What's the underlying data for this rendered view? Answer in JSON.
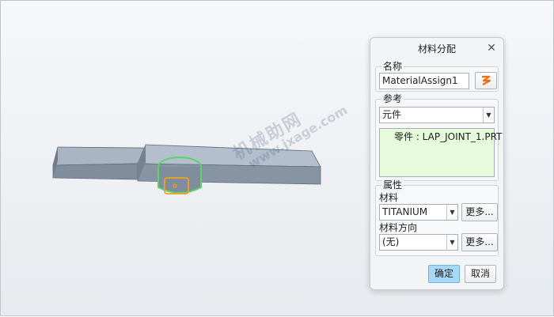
{
  "viewport": {
    "watermark_line1": "机械助网",
    "watermark_line2": "www.jxage.com",
    "model_colors": {
      "plate_top": "#a9b5c3",
      "plate_side": "#7f8d9c",
      "plate_edge": "#5f6c7a",
      "highlight_green": "#5bd36a",
      "highlight_orange": "#f0a020"
    }
  },
  "dialog": {
    "title": "材料分配",
    "close_icon": "close-icon",
    "name_group": {
      "label": "名称",
      "value": "MaterialAssign1",
      "icon": "edit-name-icon"
    },
    "reference_group": {
      "label": "参考",
      "selector_value": "元件",
      "items": [
        "零件 : LAP_JOINT_1.PRT"
      ]
    },
    "properties_group": {
      "label": "属性",
      "material_label": "材料",
      "material_value": "TITANIUM",
      "more_label_1": "更多...",
      "orientation_label": "材料方向",
      "orientation_value": "(无)",
      "more_label_2": "更多..."
    },
    "ok_label": "确定",
    "cancel_label": "取消"
  }
}
